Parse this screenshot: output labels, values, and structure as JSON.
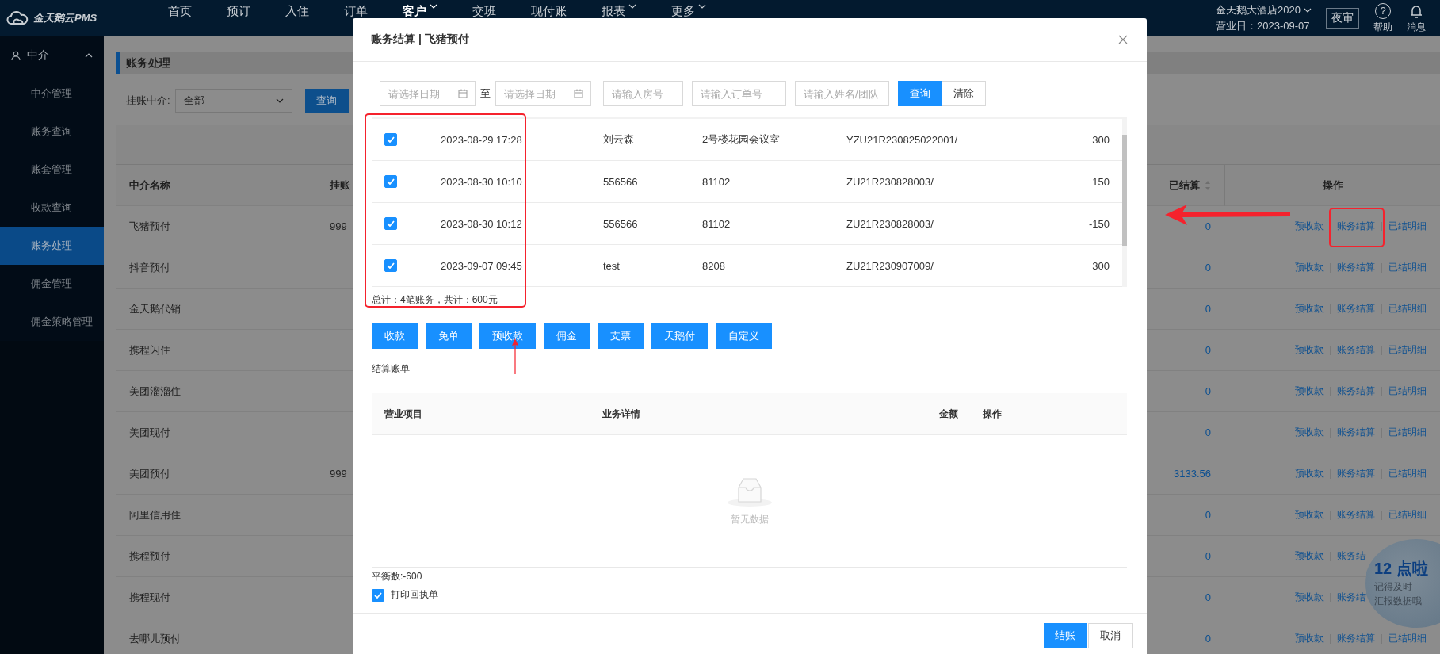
{
  "app": {
    "logo": "金天鹅云PMS"
  },
  "nav": [
    {
      "label": "首页",
      "selected": false,
      "dropdown": false
    },
    {
      "label": "预订",
      "selected": false,
      "dropdown": false
    },
    {
      "label": "入住",
      "selected": false,
      "dropdown": false
    },
    {
      "label": "订单",
      "selected": false,
      "dropdown": false
    },
    {
      "label": "客户",
      "selected": true,
      "dropdown": true
    },
    {
      "label": "交班",
      "selected": false,
      "dropdown": false
    },
    {
      "label": "现付账",
      "selected": false,
      "dropdown": false
    },
    {
      "label": "报表",
      "selected": false,
      "dropdown": true
    },
    {
      "label": "更多",
      "selected": false,
      "dropdown": true
    }
  ],
  "hotel": {
    "name": "金天鹅大酒店2020",
    "business_date": "营业日：2023-09-07",
    "night_audit": "夜审",
    "help_icon": "?",
    "help": "帮助",
    "messages": "消息"
  },
  "sidebar": {
    "group": "中介",
    "expanded": true,
    "items": [
      {
        "label": "中介管理",
        "selected": false
      },
      {
        "label": "账务查询",
        "selected": false
      },
      {
        "label": "账套管理",
        "selected": false
      },
      {
        "label": "收款查询",
        "selected": false
      },
      {
        "label": "账务处理",
        "selected": true
      },
      {
        "label": "佣金管理",
        "selected": false
      },
      {
        "label": "佣金策略管理",
        "selected": false
      }
    ]
  },
  "page": {
    "title": "账务处理",
    "filter_label": "挂账中介:",
    "filter_value": "全部",
    "query": "查询"
  },
  "table": {
    "columns": [
      "中介名称",
      "挂账",
      "已结算",
      "操作"
    ],
    "rows": [
      {
        "name": "飞猪预付",
        "column_2": "999",
        "settled": "0",
        "actions": [
          "预收款",
          "账务结算",
          "已结明细"
        ]
      },
      {
        "name": "抖音预付",
        "settled": "0",
        "actions": [
          "预收款",
          "账务结算",
          "已结明细"
        ]
      },
      {
        "name": "金天鹅代销",
        "settled": "0",
        "actions": [
          "预收款",
          "账务结算",
          "已结明细"
        ]
      },
      {
        "name": "携程闪住",
        "settled": "0",
        "actions": [
          "预收款",
          "账务结算",
          "已结明细"
        ]
      },
      {
        "name": "美团溜溜住",
        "settled": "0",
        "actions": [
          "预收款",
          "账务结算",
          "已结明细"
        ]
      },
      {
        "name": "美团现付",
        "settled": "0",
        "actions": [
          "预收款",
          "账务结算",
          "已结明细"
        ]
      },
      {
        "name": "美团预付",
        "column_2": "999",
        "settled": "3133.56",
        "actions": [
          "预收款",
          "账务结算",
          "已结明细"
        ]
      },
      {
        "name": "阿里信用住",
        "settled": "0",
        "actions": [
          "预收款",
          "账务结算",
          "已结明细"
        ]
      },
      {
        "name": "携程预付",
        "settled": "0",
        "actions": [
          "预收款",
          "账务结"
        ]
      },
      {
        "name": "携程现付",
        "settled": "0",
        "actions": [
          "预收款",
          "账务结"
        ]
      },
      {
        "name": "去哪儿预付",
        "settled": "0",
        "actions": [
          "预收款",
          "账务结算",
          "已结明细"
        ]
      }
    ]
  },
  "dialog": {
    "title": "账务结算 | 飞猪预付",
    "date_from": {
      "placeholder": "请选择日期"
    },
    "range_separator": "至",
    "date_to": {
      "placeholder": "请选择日期"
    },
    "room": {
      "placeholder": "请输入房号"
    },
    "order": {
      "placeholder": "请输入订单号"
    },
    "guest": {
      "placeholder": "请输入姓名/团队"
    },
    "query": "查询",
    "clear": "清除",
    "entries": [
      {
        "checked": true,
        "time": "2023-08-29 17:28",
        "name": "刘云森",
        "room": "2号楼花园会议室",
        "order": "YZU21R230825022001/",
        "amount": "300"
      },
      {
        "checked": true,
        "time": "2023-08-30 10:10",
        "name": "556566",
        "room": "81102",
        "order": "ZU21R230828003/",
        "amount": "150"
      },
      {
        "checked": true,
        "time": "2023-08-30 10:12",
        "name": "556566",
        "room": "81102",
        "order": "ZU21R230828003/",
        "amount": "-150"
      },
      {
        "checked": true,
        "time": "2023-09-07 09:45",
        "name": "test",
        "room": "8208",
        "order": "ZU21R230907009/",
        "amount": "300"
      }
    ],
    "summary": "总计：4笔账务，共计：600元",
    "payment_buttons": [
      "收款",
      "免单",
      "预收款",
      "佣金",
      "支票",
      "天鹅付",
      "自定义"
    ],
    "bill": {
      "title": "结算账单",
      "columns": [
        "营业项目",
        "业务详情",
        "金额",
        "操作"
      ],
      "empty": "暂无数据"
    },
    "balance": "平衡数:-600",
    "print_receipt": {
      "label": "打印回执单",
      "checked": true
    },
    "confirm": "结账",
    "cancel": "取消"
  },
  "promo": {
    "title": "12 点啦",
    "lines": [
      "记得及时",
      "汇报数据哦"
    ]
  }
}
